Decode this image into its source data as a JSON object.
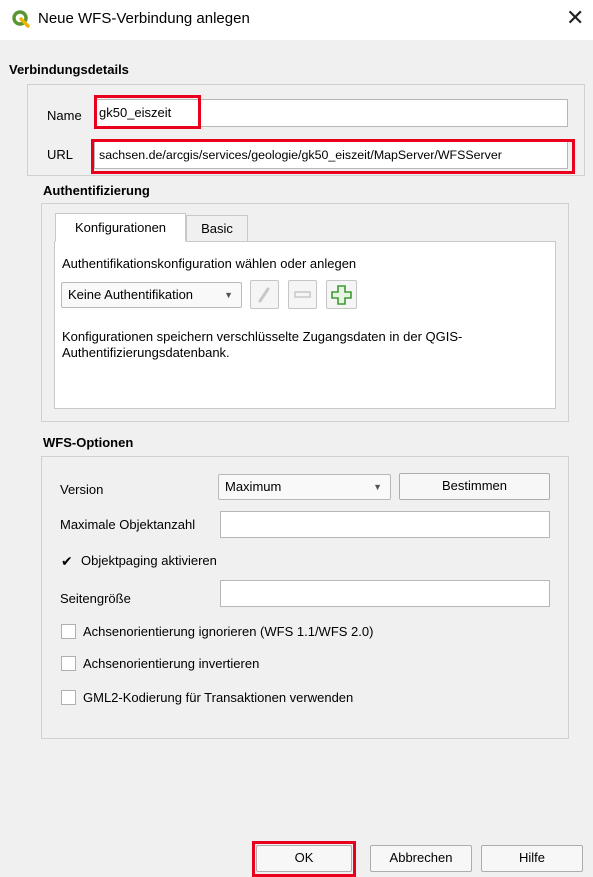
{
  "window": {
    "title": "Neue WFS-Verbindung anlegen",
    "close_glyph": "✕",
    "icon": "qgis-logo-icon"
  },
  "connection": {
    "section_title": "Verbindungsdetails",
    "name_label": "Name",
    "name_value": "gk50_eiszeit",
    "url_label": "URL",
    "url_value": "sachsen.de/arcgis/services/geologie/gk50_eiszeit/MapServer/WFSServer"
  },
  "auth": {
    "section_title": "Authentifizierung",
    "tabs": [
      {
        "label": "Konfigurationen",
        "active": true
      },
      {
        "label": "Basic",
        "active": false
      }
    ],
    "prompt": "Authentifikationskonfiguration wählen oder anlegen",
    "config_selected": "Keine Authentifikation",
    "icons": [
      "edit-pencil-icon",
      "remove-icon",
      "add-plus-icon"
    ],
    "info_text": "Konfigurationen speichern verschlüsselte Zugangsdaten in der QGIS-Authentifizierungsdatenbank."
  },
  "wfs": {
    "section_title": "WFS-Optionen",
    "version_label": "Version",
    "version_value": "Maximum",
    "detect_button": "Bestimmen",
    "max_features_label": "Maximale Objektanzahl",
    "max_features_value": "",
    "paging_label": "Objektpaging aktivieren",
    "paging_checked": true,
    "page_size_label": "Seitengröße",
    "page_size_value": "",
    "ignore_axis_label": "Achsenorientierung ignorieren (WFS 1.1/WFS 2.0)",
    "ignore_axis_checked": false,
    "invert_axis_label": "Achsenorientierung invertieren",
    "invert_axis_checked": false,
    "gml2_label": "GML2-Kodierung für Transaktionen verwenden",
    "gml2_checked": false
  },
  "buttons": {
    "ok": "OK",
    "cancel": "Abbrechen",
    "help": "Hilfe"
  },
  "colors": {
    "highlight": "#e8001c",
    "qgis_green": "#589632",
    "add_green": "#3d9b35"
  }
}
